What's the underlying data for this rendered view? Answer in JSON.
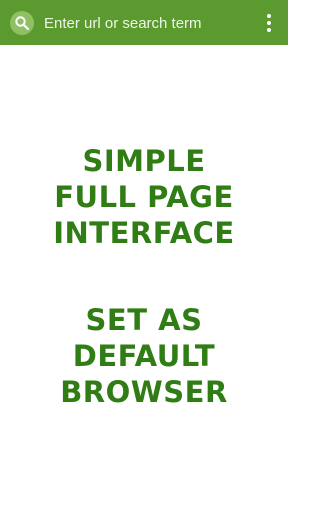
{
  "toolbar": {
    "search_icon": "search-icon",
    "url_placeholder": "Enter url or search term",
    "menu_icon": "more-vert-icon",
    "background_color": "#5b9a2e"
  },
  "promo": {
    "block1": [
      "SIMPLE",
      "FULL PAGE",
      "INTERFACE"
    ],
    "block2": [
      "SET AS",
      "DEFAULT",
      "BROWSER"
    ],
    "text_color": "#2f7d14"
  }
}
